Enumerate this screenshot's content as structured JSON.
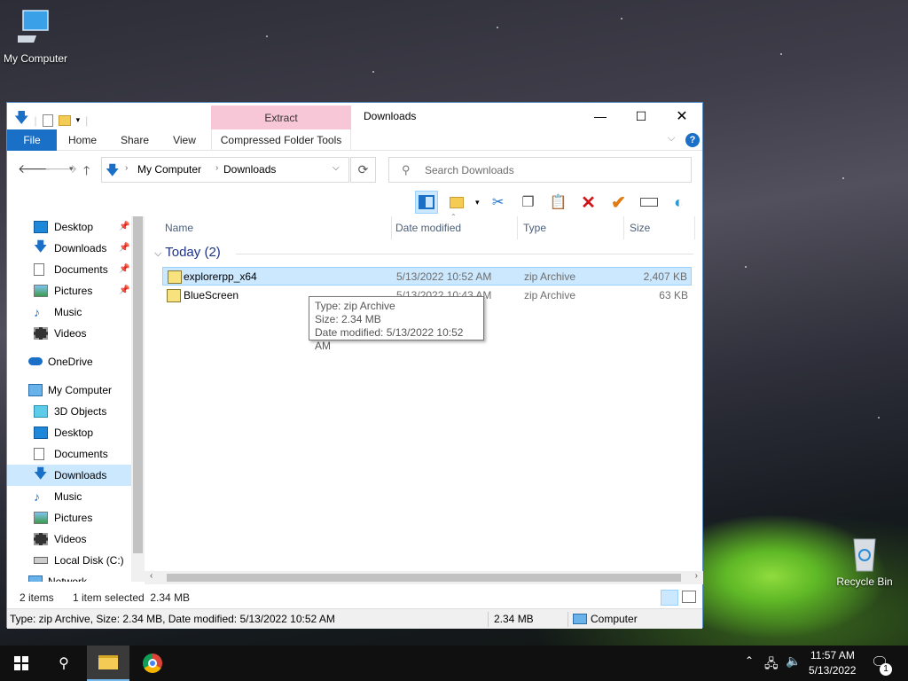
{
  "desktop": {
    "my_computer_label": "My Computer",
    "recycle_bin_label": "Recycle Bin"
  },
  "window": {
    "title": "Downloads",
    "context_tab_group": "Extract",
    "tabs": [
      "File",
      "Home",
      "Share",
      "View",
      "Compressed Folder Tools"
    ],
    "address": {
      "crumbs": [
        "My Computer",
        "Downloads"
      ]
    },
    "search": {
      "placeholder": "Search Downloads"
    }
  },
  "nav_pane": {
    "items": [
      {
        "label": "Desktop",
        "icon": "desktop-icon",
        "pinned": true
      },
      {
        "label": "Downloads",
        "icon": "download-arrow-icon",
        "pinned": true
      },
      {
        "label": "Documents",
        "icon": "documents-icon",
        "pinned": true
      },
      {
        "label": "Pictures",
        "icon": "pictures-icon",
        "pinned": true
      },
      {
        "label": "Music",
        "icon": "music-note-icon",
        "pinned": false
      },
      {
        "label": "Videos",
        "icon": "film-icon",
        "pinned": false
      },
      {
        "label": "OneDrive",
        "icon": "cloud-icon",
        "pinned": false
      },
      {
        "label": "My Computer",
        "icon": "computer-icon",
        "pinned": false
      },
      {
        "label": "3D Objects",
        "icon": "cube-icon",
        "pinned": false
      },
      {
        "label": "Desktop",
        "icon": "desktop-icon",
        "pinned": false
      },
      {
        "label": "Documents",
        "icon": "documents-icon",
        "pinned": false
      },
      {
        "label": "Downloads",
        "icon": "download-arrow-icon",
        "pinned": false,
        "selected": true
      },
      {
        "label": "Music",
        "icon": "music-note-icon",
        "pinned": false
      },
      {
        "label": "Pictures",
        "icon": "pictures-icon",
        "pinned": false
      },
      {
        "label": "Videos",
        "icon": "film-icon",
        "pinned": false
      },
      {
        "label": "Local Disk (C:)",
        "icon": "drive-icon",
        "pinned": false
      },
      {
        "label": "Network",
        "icon": "network-icon",
        "pinned": false
      }
    ]
  },
  "file_list": {
    "columns": [
      "Name",
      "Date modified",
      "Type",
      "Size"
    ],
    "group_label": "Today (2)",
    "rows": [
      {
        "name": "explorerpp_x64",
        "date": "5/13/2022 10:52 AM",
        "type": "zip Archive",
        "size": "2,407 KB",
        "selected": true
      },
      {
        "name": "BlueScreen",
        "date": "5/13/2022 10:43 AM",
        "type": "zip Archive",
        "size": "63 KB",
        "selected": false
      }
    ]
  },
  "tooltip": {
    "type_line": "Type: zip Archive",
    "size_line": "Size: 2.34 MB",
    "date_line": "Date modified: 5/13/2022 10:52 AM"
  },
  "status": {
    "item_count": "2 items",
    "selection": "1 item selected  2.34 MB"
  },
  "details_bar": {
    "info": "Type: zip Archive, Size: 2.34 MB, Date modified: 5/13/2022 10:52 AM",
    "size": "2.34 MB",
    "location": "Computer"
  },
  "taskbar": {
    "time": "11:57 AM",
    "date": "5/13/2022",
    "notification_count": "1"
  },
  "colors": {
    "accent": "#1a6fc7",
    "selection": "#cce8ff",
    "context_tab": "#f7c6d7"
  }
}
